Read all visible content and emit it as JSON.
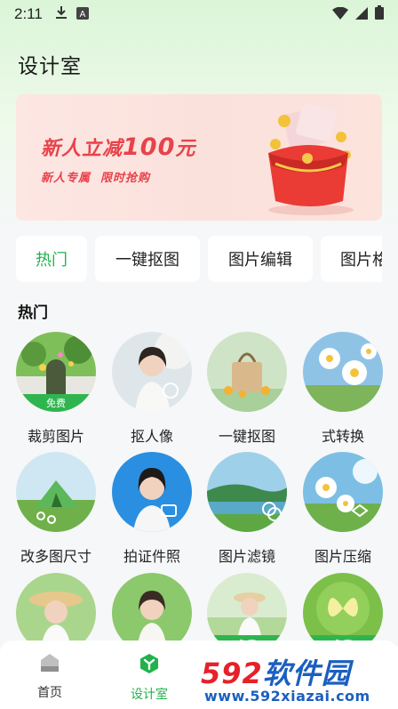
{
  "status_bar": {
    "time": "2:11",
    "icons": [
      "download-icon",
      "font-icon",
      "wifi-icon",
      "signal-icon",
      "battery-icon"
    ]
  },
  "page": {
    "title": "设计室"
  },
  "banner": {
    "headline_prefix": "新人立减",
    "headline_amount": "100",
    "headline_suffix": "元",
    "subline": "新人专属  限时抢购",
    "accent_color": "#e8424a"
  },
  "tabs": [
    {
      "label": "热门",
      "active": true
    },
    {
      "label": "一键抠图",
      "active": false
    },
    {
      "label": "图片编辑",
      "active": false
    },
    {
      "label": "图片格",
      "active": false
    }
  ],
  "section": {
    "title": "热门"
  },
  "tools": [
    {
      "label": "裁剪图片",
      "badge": "免费",
      "icon": "wreath-door-photo"
    },
    {
      "label": "抠人像",
      "badge": "",
      "icon": "portrait-photo"
    },
    {
      "label": "一键抠图",
      "badge": "",
      "icon": "handbag-photo"
    },
    {
      "label": "式转换",
      "badge": "",
      "icon": "flowers-photo"
    },
    {
      "label": "改多图尺寸",
      "badge": "",
      "icon": "tent-photo"
    },
    {
      "label": "拍证件照",
      "badge": "",
      "icon": "id-photo"
    },
    {
      "label": "图片滤镜",
      "badge": "",
      "icon": "lake-photo"
    },
    {
      "label": "图片压缩",
      "badge": "",
      "icon": "daisy-photo"
    },
    {
      "label": "",
      "badge": "",
      "icon": "girl-hat-photo"
    },
    {
      "label": "",
      "badge": "",
      "icon": "girl-garden-photo"
    },
    {
      "label": "",
      "badge": "免费",
      "icon": "girl-field-photo"
    },
    {
      "label": "",
      "badge": "免费",
      "icon": "butterfly-photo"
    }
  ],
  "bottom_nav": [
    {
      "label": "首页",
      "icon": "home-icon",
      "active": false
    },
    {
      "label": "设计室",
      "icon": "design-icon",
      "active": true
    }
  ],
  "watermark": {
    "brand_number": "592",
    "brand_text": "软件园",
    "url": "www.592xiazai.com"
  },
  "colors": {
    "accent": "#21b24b",
    "banner_red": "#e8424a"
  }
}
